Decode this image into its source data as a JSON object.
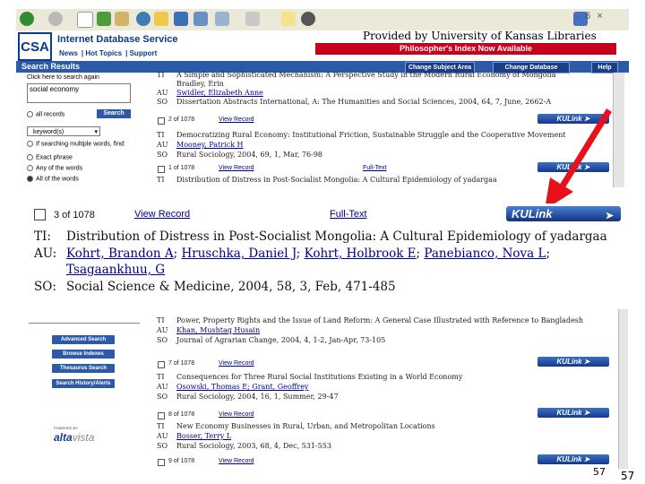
{
  "browser": {
    "toolbar_icons": [
      "back-icon",
      "forward-icon",
      "stop-icon",
      "refresh-icon",
      "home-icon",
      "search-icon",
      "favorites-icon",
      "media-icon",
      "history-icon",
      "mail-icon",
      "print-icon",
      "edit-icon",
      "discuss-icon"
    ],
    "window_controls": "– 6 ×"
  },
  "header": {
    "logo": "CSA",
    "service_name": "Internet Database Service",
    "nav": [
      "News",
      "Hot Topics",
      "Support"
    ],
    "provided_by": "Provided by University of Kansas Libraries",
    "philosophers_banner": "Philosopher's Index Now Available",
    "search_results": "Search Results",
    "buttons": [
      "Change Subject Area",
      "Change Database",
      "Help"
    ]
  },
  "sidebar": {
    "click_here": "Click here to search again",
    "query": "social economy",
    "all_records": "all records",
    "search_button": "Search",
    "field": "keyword(s)",
    "multiple_words": "If searching multiple words, find:",
    "options": [
      "Exact phrase",
      "Any of the words",
      "All of the words"
    ],
    "lower_buttons": [
      "Advanced Search",
      "Browse Indexes",
      "Thesaurus Search",
      "Search History/Alerts"
    ],
    "powered_by": "POWERED BY",
    "altavista_a": "alta",
    "altavista_b": "vista"
  },
  "top_results": [
    {
      "lines": [
        {
          "key": "TI",
          "text": "A Simple and Sophisticated Mechanism: A Perspective Study in the Modern Rural Economy of Mongolia"
        },
        {
          "key": "",
          "text": "Bradley, Erin"
        },
        {
          "key": "AU",
          "text": "Swidler, Elizabeth Anne",
          "link": true
        },
        {
          "key": "SO",
          "text": "Dissertation Abstracts International, A: The Humanities and Social Sciences, 2004, 64, 7, June, 2662-A"
        }
      ],
      "count": "2 of 1078",
      "view": "View Record",
      "fulltext": "",
      "kulink": "KULink"
    },
    {
      "lines": [
        {
          "key": "TI",
          "text": "Democratizing Rural Economy: Institutional Friction, Sustainable Struggle and the Cooperative Movement"
        },
        {
          "key": "AU",
          "text": "Mooney, Patrick H",
          "link": true
        },
        {
          "key": "SO",
          "text": "Rural Sociology, 2004, 69, 1, Mar, 76-98"
        }
      ],
      "count": "1 of 1078",
      "view": "View Record",
      "fulltext": "Full-Text",
      "kulink": "KULink"
    },
    {
      "lines": [
        {
          "key": "TI",
          "text": "Distribution of Distress in Post-Socialist Mongolia: A Cultural Epidemiology of yadargaa"
        }
      ],
      "count": "",
      "view": "",
      "fulltext": "",
      "kulink": ""
    }
  ],
  "zoom_record": {
    "count": "3 of 1078",
    "view": "View Record",
    "fulltext": "Full-Text",
    "kulink": "KULink",
    "ti_key": "TI:",
    "ti": "Distribution of Distress in Post-Socialist Mongolia: A Cultural Epidemiology of yadargaa",
    "au_key": "AU:",
    "authors": [
      "Kohrt, Brandon A",
      "Hruschka, Daniel J",
      "Kohrt, Holbrook E",
      "Panebianco, Nova L",
      "Tsagaankhuu, G"
    ],
    "sep": ";",
    "so_key": "SO:",
    "so": "Social Science & Medicine, 2004, 58, 3, Feb, 471-485"
  },
  "bottom_results": [
    {
      "lines": [
        {
          "key": "TI",
          "text": "Power, Property Rights and the Issue of Land Reform: A General Case Illustrated with Reference to Bangladesh"
        },
        {
          "key": "AU",
          "text": "Khan, Mushtaq Husain",
          "link": true
        },
        {
          "key": "SO",
          "text": "Journal of Agrarian Change, 2004, 4, 1-2, Jan-Apr, 73-105"
        }
      ],
      "count": "7 of 1078",
      "view": "View Record",
      "kulink": "KULink"
    },
    {
      "lines": [
        {
          "key": "TI",
          "text": "Consequences for Three Rural Social Institutions Existing in a World Economy"
        },
        {
          "key": "AU",
          "text": "Osowski, Thomas E; Grant, Geoffrey",
          "link": true
        },
        {
          "key": "SO",
          "text": "Rural Sociology, 2004, 16, 1, Summer, 29-47"
        }
      ],
      "count": "8 of 1078",
      "view": "View Record",
      "kulink": "KULink"
    },
    {
      "lines": [
        {
          "key": "TI",
          "text": "New Economy Businesses in Rural, Urban, and Metropolitan Locations"
        },
        {
          "key": "AU",
          "text": "Bosser, Terry L",
          "link": true
        },
        {
          "key": "SO",
          "text": "Rural Sociology, 2003, 68, 4, Dec, 531-553"
        }
      ],
      "count": "9 of 1078",
      "view": "View Record",
      "kulink": "KULink"
    }
  ],
  "page_numbers": [
    "57",
    "57"
  ],
  "colors": {
    "csa_blue": "#2d5aa8",
    "banner_red": "#c8001e",
    "arrow_red": "#e8101a"
  }
}
